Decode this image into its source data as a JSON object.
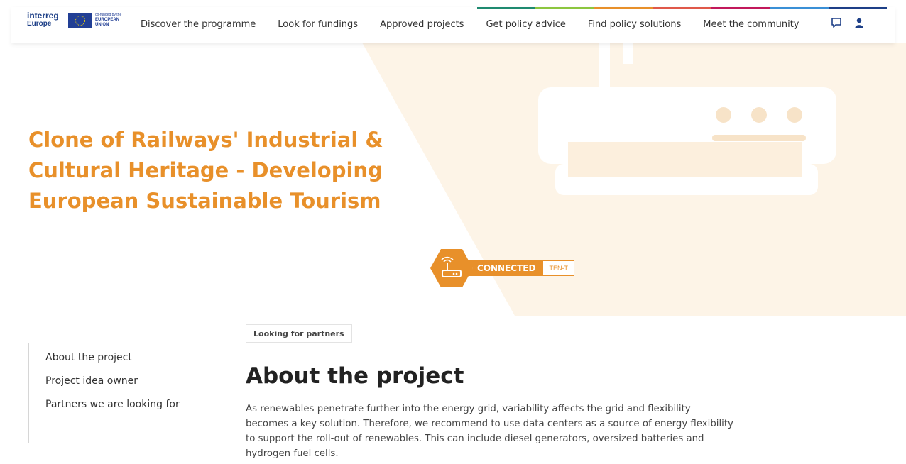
{
  "header": {
    "logo": {
      "brand_line1": "interreg",
      "brand_line2": "Europe",
      "eu_line1": "co-funded by the",
      "eu_line2": "EUROPEAN",
      "eu_line3": "UNION"
    },
    "nav": [
      "Discover the programme",
      "Look for fundings",
      "Approved projects",
      "Get policy advice",
      "Find policy solutions",
      "Meet the community"
    ],
    "stripe_colors": [
      "#1f8a70",
      "#8cc63f",
      "#e8902a",
      "#e0584a",
      "#c2185b",
      "#3a8fd6",
      "#1d3f87"
    ],
    "icons": [
      "chat-icon",
      "user-icon"
    ]
  },
  "hero": {
    "title": "Clone of Railways' Industrial & Cultural Heritage - Developing European Sustainable Tourism",
    "badge": {
      "label": "CONNECTED",
      "tag": "TEN-T",
      "icon": "router-icon"
    },
    "accent_color": "#e8902a",
    "bg_shape_color": "#fdf3e6"
  },
  "content": {
    "status_tag": "Looking for partners",
    "sidebar": [
      "About the project",
      "Project idea owner",
      "Partners we are looking for"
    ],
    "section_title": "About the project",
    "body": "As renewables penetrate further into the energy grid, variability affects the grid and flexibility becomes a key solution. Therefore, we recommend to use data centers as a source of energy flexibility to support the roll-out of renewables. This can include diesel generators, oversized batteries and hydrogen fuel cells."
  }
}
